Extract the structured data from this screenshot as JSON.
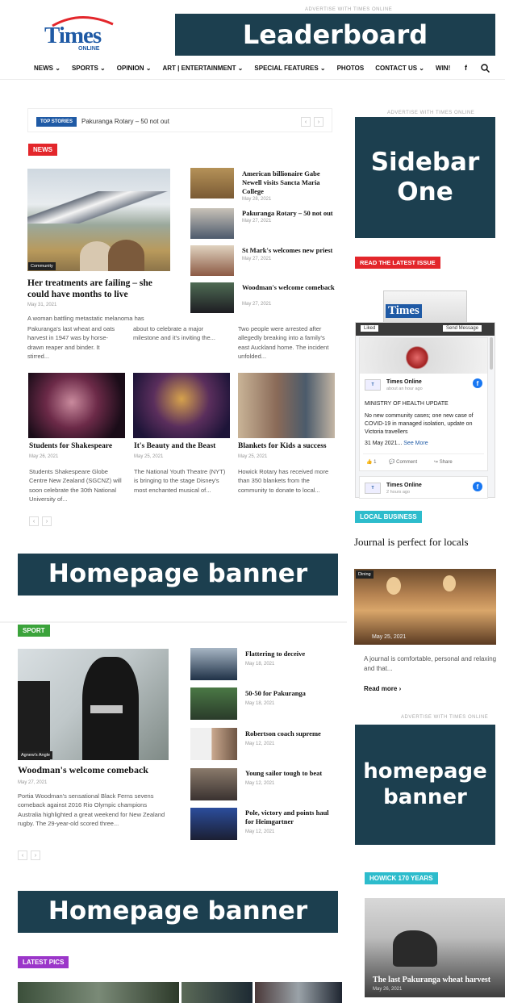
{
  "header": {
    "ad_note": "ADVERTISE WITH TIMES ONLINE",
    "logo_main": "Times",
    "logo_sub": "ONLINE",
    "leaderboard": "Leaderboard"
  },
  "nav": {
    "items": [
      "NEWS ⌄",
      "SPORTS ⌄",
      "OPINION ⌄",
      "ART | ENTERTAINMENT ⌄",
      "SPECIAL FEATURES ⌄",
      "PHOTOS",
      "CONTACT US ⌄",
      "WIN!"
    ],
    "facebook": "f"
  },
  "ticker": {
    "label": "TOP STORIES",
    "text": "Pakuranga Rotary – 50 not out"
  },
  "news": {
    "tag": "NEWS",
    "main_badge": "Community",
    "main_title": "Her treatments are failing – she could have months to live",
    "main_date": "May 31, 2021",
    "main_excerpt": "A woman battling metastatic melanoma has",
    "side": [
      {
        "t": "American billionaire Gabe Newell visits Sancta Maria College",
        "d": "May 28, 2021"
      },
      {
        "t": "Pakuranga Rotary – 50 not out",
        "d": "May 27, 2021"
      },
      {
        "t": "St Mark's welcomes new priest",
        "d": "May 27, 2021"
      },
      {
        "t": "Woodman's welcome comeback",
        "d": "May 27, 2021"
      }
    ],
    "cols": [
      "Pakuranga's last wheat and oats harvest in 1947 was by horse-drawn reaper and binder. It stirred...",
      "about to celebrate a major milestone and it's inviting the...",
      "Two people were arrested after allegedly breaking into a family's east Auckland home. The incident unfolded..."
    ],
    "cards": [
      {
        "t": "Students for Shakespeare",
        "d": "May 26, 2021",
        "e": "Students Shakespeare Globe Centre New Zealand (SGCNZ) will soon celebrate the 30th National University of..."
      },
      {
        "t": "It's Beauty and the Beast",
        "d": "May 25, 2021",
        "e": "The National Youth Theatre (NYT) is bringing to the stage Disney's most enchanted musical of..."
      },
      {
        "t": "Blankets for Kids a success",
        "d": "May 25, 2021",
        "e": "Howick Rotary has received more than 350 blankets from the community to donate to local..."
      }
    ]
  },
  "banners": {
    "home1": "Homepage banner",
    "home2": "Homepage banner",
    "side_home": "homepage banner",
    "sidebar_one": "Sidebar One"
  },
  "sport": {
    "tag": "SPORT",
    "main_badge": "Agnew's Angle",
    "main_title": "Woodman's welcome comeback",
    "main_date": "May 27, 2021",
    "main_excerpt": "Portia Woodman's sensational Black Ferns sevens comeback against 2016 Rio Olympic champions Australia highlighted a great weekend for New Zealand rugby. The 29-year-old scored three...",
    "side": [
      {
        "t": "Flattering to deceive",
        "d": "May 18, 2021"
      },
      {
        "t": "50-50 for Pakuranga",
        "d": "May 18, 2021"
      },
      {
        "t": "Robertson coach supreme",
        "d": "May 12, 2021"
      },
      {
        "t": "Young sailor tough to beat",
        "d": "May 12, 2021"
      },
      {
        "t": "Pole, victory and points haul for Heimgartner",
        "d": "May 12, 2021"
      }
    ]
  },
  "latest": {
    "tag": "LATEST PICS"
  },
  "sidebar": {
    "issue_tag": "READ THE LATEST ISSUE",
    "fb_liked": "Liked",
    "fb_send": "Send Message",
    "fb_name": "Times Online",
    "fb_time": "about an hour ago",
    "fb_head": "MINISTRY OF HEALTH UPDATE",
    "fb_body": "No new community cases; one new case of COVID-19 in managed isolation, update on Victoria travellers",
    "fb_date": "31 May 2021...",
    "fb_more": "See More",
    "fb_likes": "1",
    "fb_comment": "Comment",
    "fb_share": "Share",
    "fb_name2": "Times Online",
    "fb_time2": "2 hours ago",
    "local_tag": "LOCAL BUSINESS",
    "local_title": "Journal is perfect for locals",
    "local_badge": "Dining",
    "local_date": "May 25, 2021",
    "local_excerpt": "A journal is comfortable, personal and relaxing and that...",
    "read_more": "Read more",
    "howick_tag": "HOWICK 170 YEARS",
    "howick_title": "The last Pakuranga wheat harvest",
    "howick_date": "May 26, 2021"
  },
  "colors": {
    "navy": "#1c3f4f",
    "red": "#e3262b",
    "green": "#3ba33b",
    "teal": "#2dbccc",
    "purple": "#9b36c9",
    "blue": "#1f5aa5"
  }
}
